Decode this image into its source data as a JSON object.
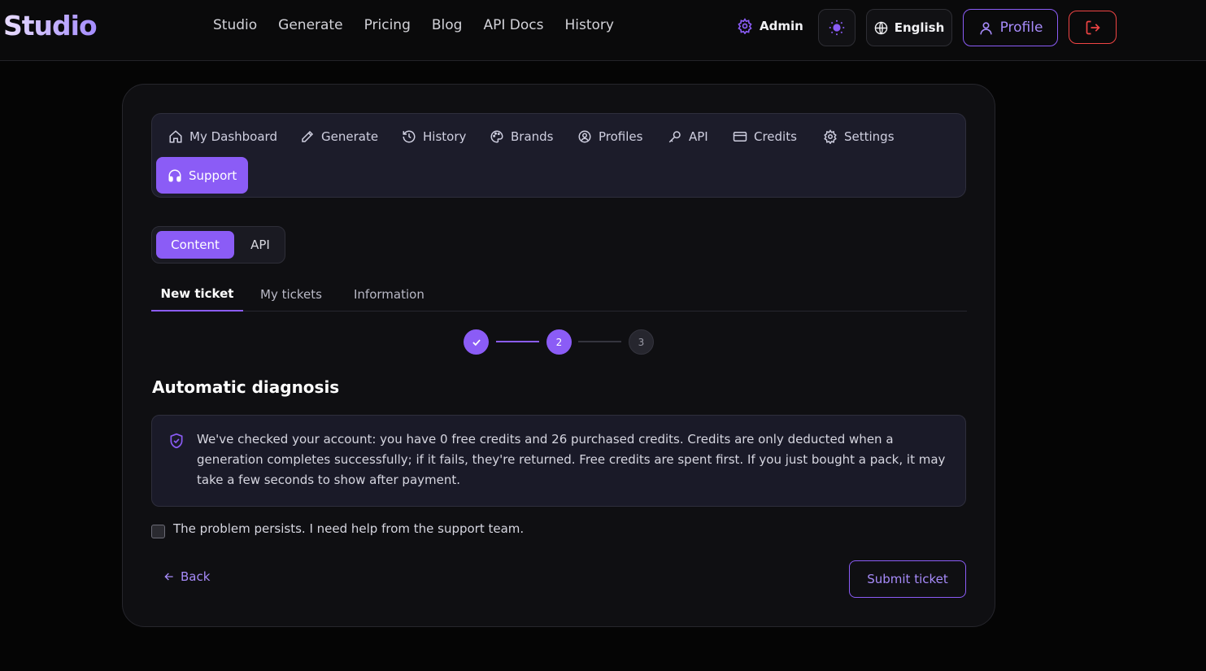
{
  "app": {
    "logo": "Studio"
  },
  "topnav": {
    "items": [
      "Studio",
      "Generate",
      "Pricing",
      "Blog",
      "API Docs",
      "History"
    ],
    "admin_label": "Admin",
    "language": "English",
    "profile_label": "Profile"
  },
  "menu": {
    "items": [
      {
        "label": "My Dashboard",
        "icon": "home-icon"
      },
      {
        "label": "Generate",
        "icon": "pencil-icon"
      },
      {
        "label": "History",
        "icon": "history-icon"
      },
      {
        "label": "Brands",
        "icon": "palette-icon"
      },
      {
        "label": "Profiles",
        "icon": "profile-gear-icon"
      },
      {
        "label": "API",
        "icon": "key-icon"
      },
      {
        "label": "Credits",
        "icon": "card-icon"
      },
      {
        "label": "Settings",
        "icon": "gear-icon"
      },
      {
        "label": "Support",
        "icon": "headphones-icon",
        "active": true
      }
    ]
  },
  "segment": {
    "options": [
      "Content",
      "API"
    ],
    "selected": "Content"
  },
  "tabs": {
    "items": [
      "New ticket",
      "My tickets",
      "Information"
    ],
    "active": "New ticket"
  },
  "stepper": {
    "steps": [
      "",
      "2",
      "3"
    ],
    "current": 2
  },
  "diagnosis": {
    "title": "Automatic diagnosis",
    "message": "We've checked your account: you have 0 free credits and 26 purchased credits. Credits are only deducted when a generation completes successfully; if it fails, they're returned. Free credits are spent first. If you just bought a pack, it may take a few seconds to show after payment."
  },
  "checkbox": {
    "label": "The problem persists. I need help from the support team.",
    "checked": false
  },
  "actions": {
    "back_label": "Back",
    "submit_label": "Submit ticket"
  },
  "colors": {
    "accent": "#8b5cf6",
    "accent_text": "#a78bfa",
    "danger": "#ef4444",
    "background": "#050505"
  }
}
